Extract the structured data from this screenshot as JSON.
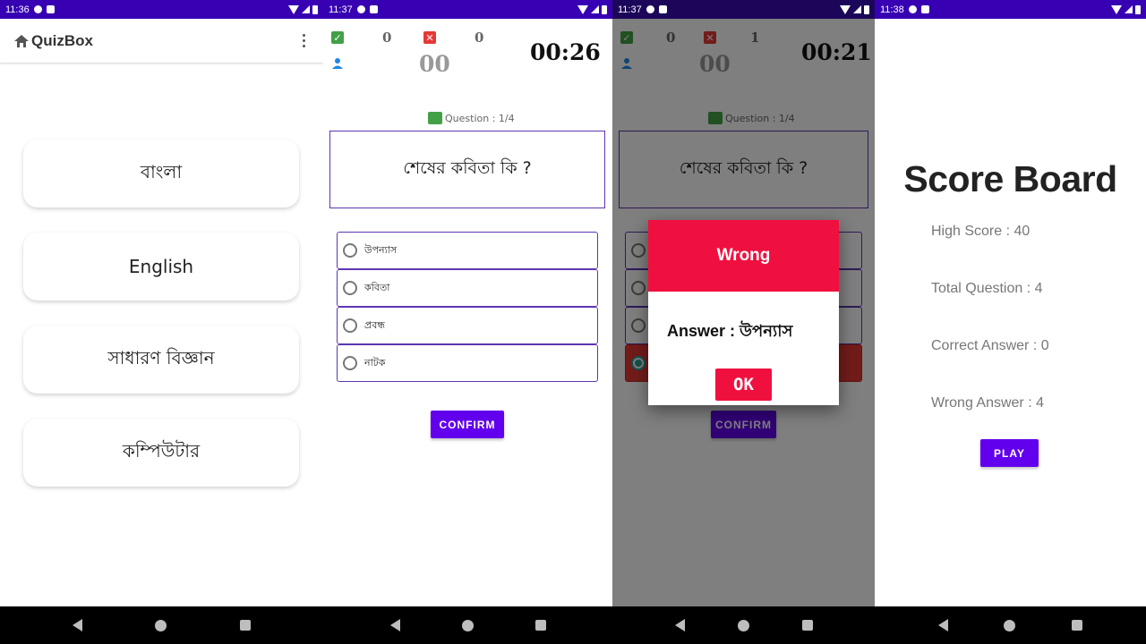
{
  "colors": {
    "accent": "#6200EE",
    "status_bar": "#3700B3",
    "wrong": "#F0103F",
    "correct_icon": "#43A047"
  },
  "screen1": {
    "status_time": "11:36",
    "app_title": "QuizBox",
    "subjects": [
      "বাংলা",
      "English",
      "সাধারণ বিজ্ঞান",
      "কম্পিউটার"
    ]
  },
  "screen2": {
    "status_time": "11:37",
    "correct_count": "0",
    "wrong_count": "0",
    "score": "00",
    "timer": "00:26",
    "question_counter": "Question : 1/4",
    "question": "শেষের কবিতা কি ?",
    "options": [
      "উপন্যাস",
      "কবিতা",
      "প্রবন্ধ",
      "নাটক"
    ],
    "confirm_label": "CONFIRM"
  },
  "screen3": {
    "status_time": "11:37",
    "correct_count": "0",
    "wrong_count": "1",
    "score": "00",
    "timer": "00:21",
    "question_counter": "Question : 1/4",
    "question": "শেষের কবিতা কি ?",
    "confirm_label": "CONFIRM",
    "dialog": {
      "title": "Wrong",
      "answer": "Answer :  উপন্যাস",
      "ok_label": "OK"
    }
  },
  "screen4": {
    "status_time": "11:38",
    "title": "Score Board",
    "high_score": "High Score : 40",
    "total_question": "Total Question : 4",
    "correct_answer": "Correct Answer : 0",
    "wrong_answer": "Wrong Answer : 4",
    "play_label": "PLAY"
  }
}
